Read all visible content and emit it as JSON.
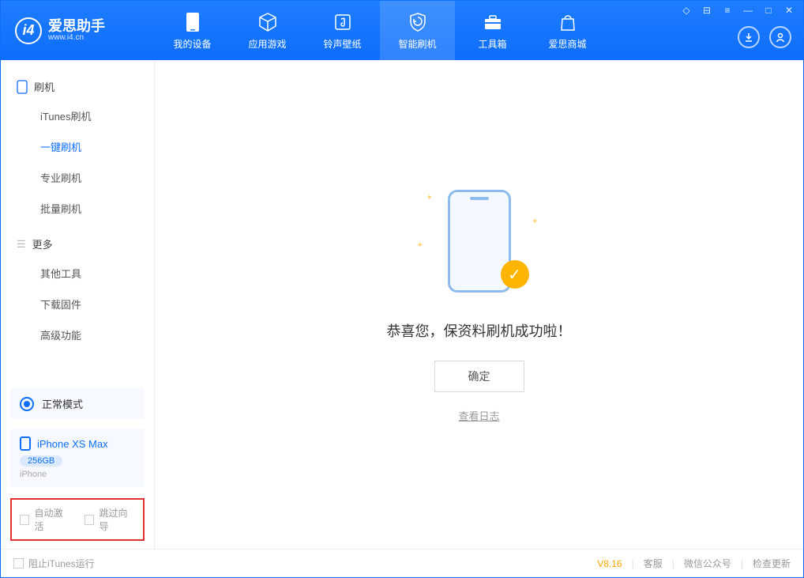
{
  "app": {
    "title": "爱思助手",
    "subtitle": "www.i4.cn"
  },
  "nav": {
    "device": "我的设备",
    "apps": "应用游戏",
    "rings": "铃声壁纸",
    "flash": "智能刷机",
    "tools": "工具箱",
    "store": "爱思商城"
  },
  "sidebar": {
    "group_flash": "刷机",
    "itunes_flash": "iTunes刷机",
    "one_click": "一键刷机",
    "pro_flash": "专业刷机",
    "batch_flash": "批量刷机",
    "group_more": "更多",
    "other_tools": "其他工具",
    "download_fw": "下载固件",
    "advanced": "高级功能"
  },
  "mode": {
    "label": "正常模式"
  },
  "device": {
    "name": "iPhone XS Max",
    "capacity": "256GB",
    "type": "iPhone"
  },
  "options": {
    "auto_activate": "自动激活",
    "skip_guide": "跳过向导"
  },
  "main": {
    "success": "恭喜您，保资料刷机成功啦！",
    "confirm": "确定",
    "view_log": "查看日志"
  },
  "footer": {
    "block_itunes": "阻止iTunes运行",
    "version": "V8.16",
    "support": "客服",
    "wechat": "微信公众号",
    "update": "检查更新"
  }
}
